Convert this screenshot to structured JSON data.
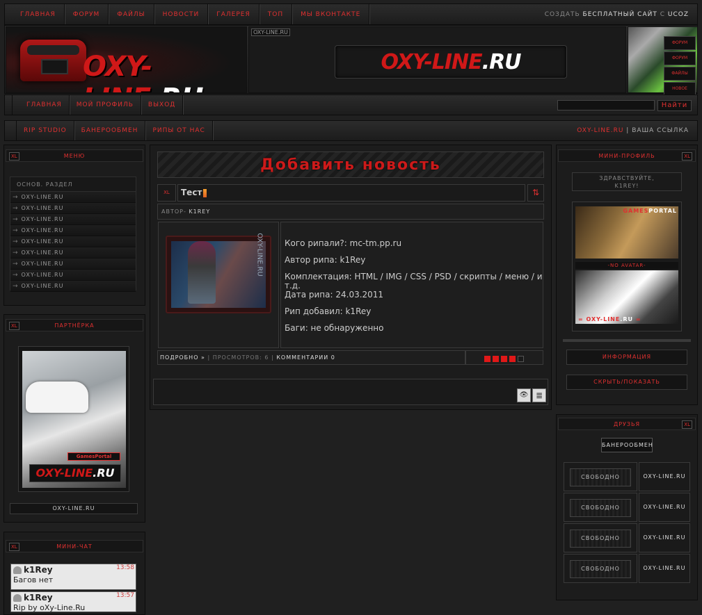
{
  "top_nav": {
    "items": [
      "Главная",
      "Форум",
      "Файлы",
      "Новости",
      "Галерея",
      "Топ",
      "Мы ВКонтакте"
    ],
    "right_prefix": "Создать ",
    "right_bold": "бесплатный сайт",
    "right_mid": " с ",
    "right_brand": "uCoz"
  },
  "header": {
    "logo_main": "OXY-LINE",
    "logo_ru": ".RU",
    "tag": "OXY-LINE.RU",
    "banner_main": "OXY-LINE",
    "banner_ru": ".RU",
    "mini_buttons": [
      "Форум",
      "Форум",
      "Файлы",
      "Новое"
    ]
  },
  "nav2": {
    "items": [
      "Главная",
      "Мой профиль",
      "Выход"
    ],
    "search_button": "Найти"
  },
  "nav3": {
    "items": [
      "Rip Studio",
      "Банерообмен",
      "Рипы от нас"
    ],
    "right_red": "OXY-LINE.RU",
    "right_sep": " | ",
    "right_gray": "Ваша ссылка"
  },
  "left": {
    "menu_title": "Меню",
    "menu_head": "Основ. раздел",
    "menu_items": [
      "oxy-line.ru",
      "oxy-line.ru",
      "oxy-line.ru",
      "oxy-line.ru",
      "oxy-line.ru",
      "oxy-line.ru",
      "oxy-line.ru",
      "oxy-line.ru",
      "oxy-line.ru"
    ],
    "partner_title": "Партнёрка",
    "partner_gp": "GamesPortal",
    "partner_logo": "OXY-LINE",
    "partner_logo_ru": ".RU",
    "partner_link": "oxy-line.ru",
    "chat_title": "Мини-чат",
    "xl": "XL",
    "chat": [
      {
        "name": "k1Rey",
        "time": "13:58",
        "msg": "Багов нет"
      },
      {
        "name": "k1Rey",
        "time": "13:57",
        "msg": "Rip by oXy-Line.Ru"
      }
    ]
  },
  "main": {
    "heading": "Добавить новость",
    "title_xl": "XL",
    "title_value": "Тест",
    "sort_icon": "⇅",
    "author_label": "Автор- ",
    "author_name": "k1Rey",
    "image_watermark": "OXY-LINE.RU",
    "lines": [
      "Кого рипали?: mc-tm.pp.ru",
      "Автор рипа: k1Rey",
      "Комплектация: HTML / IMG / CSS / PSD / скрипты / меню /  и т.д.",
      "Дата рипа: 24.03.2011",
      "Рип добавил: k1Rey",
      "Баги: не обнаруженно"
    ],
    "meta_more": "Подробно »",
    "meta_views": " | Просмотров: 6 | ",
    "meta_comments": "Комментарии 0",
    "rating_filled": 0.8,
    "icon_eye": "👁",
    "icon_doc": "≣"
  },
  "right": {
    "profile_title": "Мини-профиль",
    "xl": "XL",
    "greet_line1": "Здравствуйте,",
    "greet_line2": "k1Rey!",
    "av1_red": "GAMES",
    "av1_white": "PORTAL",
    "no_avatar": "-no avatar-",
    "av2_red1": "= OXY-LINE",
    "av2_white": ".RU",
    "av2_red2": " =",
    "info_btn": "Информация",
    "toggle_btn": "Скрыть/Показать",
    "friends_title": "Друзья",
    "banner_exchange": "Банерообмен",
    "slots": [
      {
        "free": "Свободно",
        "site": "oxy-line.ru"
      },
      {
        "free": "Свободно",
        "site": "oxy-line.ru"
      },
      {
        "free": "Свободно",
        "site": "oxy-line.ru"
      },
      {
        "free": "Свободно",
        "site": "oxy-line.ru"
      }
    ]
  }
}
